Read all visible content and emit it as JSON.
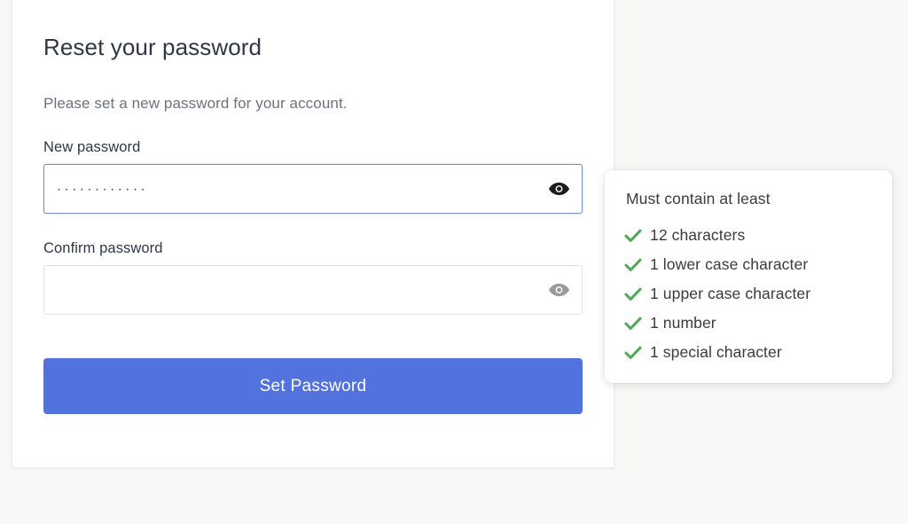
{
  "page": {
    "background_color": "#f8f8f6"
  },
  "card": {
    "title": "Reset your password",
    "subtitle": "Please set a new password for your account.",
    "fields": [
      {
        "label": "New password",
        "value": "············",
        "placeholder": "",
        "state": "focused",
        "toggle_icon": "eye-icon",
        "toggle_icon_color": "#1c1c1c"
      },
      {
        "label": "Confirm password",
        "value": "",
        "placeholder": "",
        "state": "idle",
        "toggle_icon": "eye-icon",
        "toggle_icon_color": "#9a9a9a"
      }
    ],
    "submit_label": "Set Password",
    "submit_color": "#5272de"
  },
  "requirements_panel": {
    "title": "Must contain at least",
    "check_color": "#53a95a",
    "items": [
      {
        "icon": "check-icon",
        "label": "12 characters",
        "met": true
      },
      {
        "icon": "check-icon",
        "label": "1 lower case character",
        "met": true
      },
      {
        "icon": "check-icon",
        "label": "1 upper case character",
        "met": true
      },
      {
        "icon": "check-icon",
        "label": "1 number",
        "met": true
      },
      {
        "icon": "check-icon",
        "label": "1 special character",
        "met": true
      }
    ]
  }
}
